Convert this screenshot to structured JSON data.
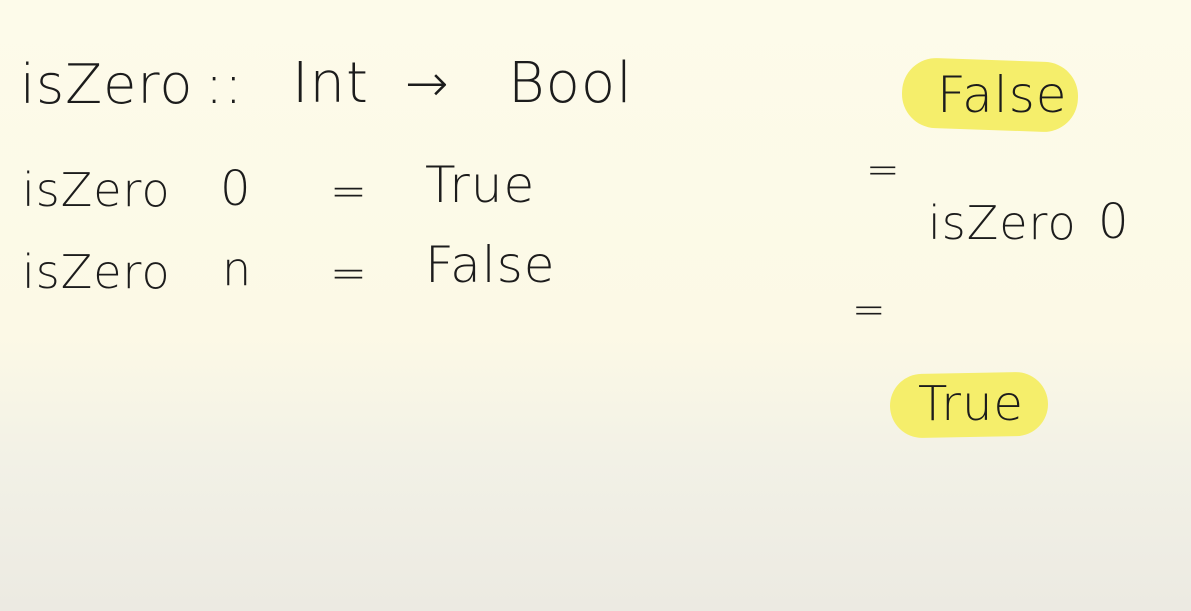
{
  "signature": {
    "name": "isZero",
    "colons": "::",
    "input_type": "Int",
    "arrow": "→",
    "output_type": "Bool"
  },
  "definition": [
    {
      "name": "isZero",
      "arg": "0",
      "eq": "=",
      "result": "True"
    },
    {
      "name": "isZero",
      "arg": "n",
      "eq": "=",
      "result": "False"
    }
  ],
  "reasoning": {
    "top": "False",
    "eq1": "=",
    "call_name": "isZero",
    "call_arg": "0",
    "eq2": "=",
    "bottom": "True"
  },
  "colors": {
    "highlight": "#f5ee6b",
    "ink": "#1c1c1c",
    "paper": "#fdfbea"
  }
}
